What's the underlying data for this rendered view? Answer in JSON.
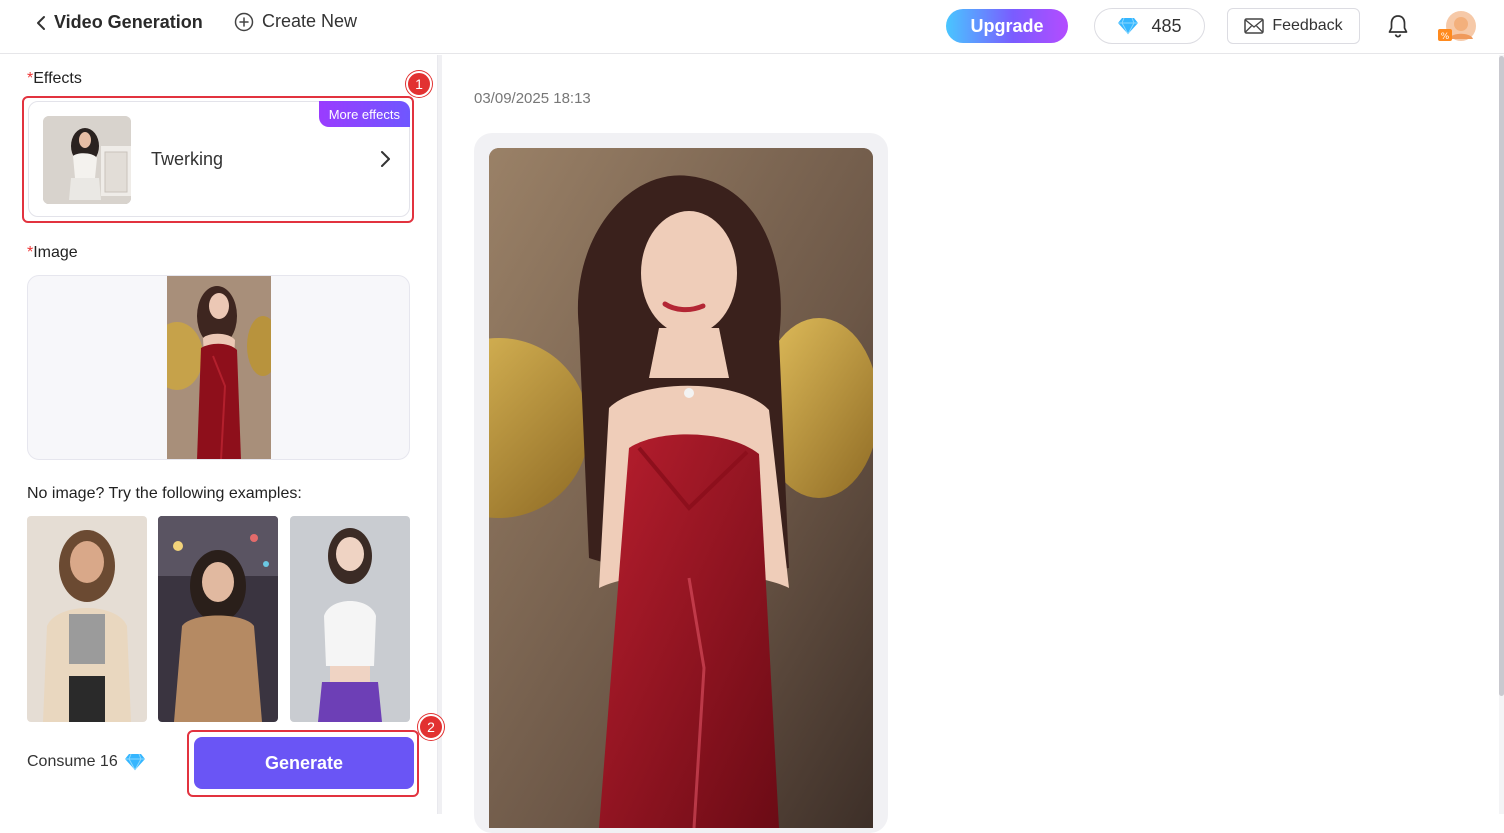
{
  "header": {
    "title": "Video Generation",
    "create_new": "Create New",
    "upgrade": "Upgrade",
    "credits": "485",
    "feedback": "Feedback"
  },
  "left": {
    "effects_label": "Effects",
    "effect_name": "Twerking",
    "more_effects": "More effects",
    "image_label": "Image",
    "examples_label": "No image? Try the following examples:",
    "consume_label": "Consume 16",
    "generate": "Generate"
  },
  "annotations": {
    "badge_1": "1",
    "badge_2": "2"
  },
  "result": {
    "timestamp": "03/09/2025 18:13"
  },
  "colors": {
    "accent": "#6a55f5",
    "highlight": "#e2333f",
    "diamond": "#35b6ff"
  }
}
